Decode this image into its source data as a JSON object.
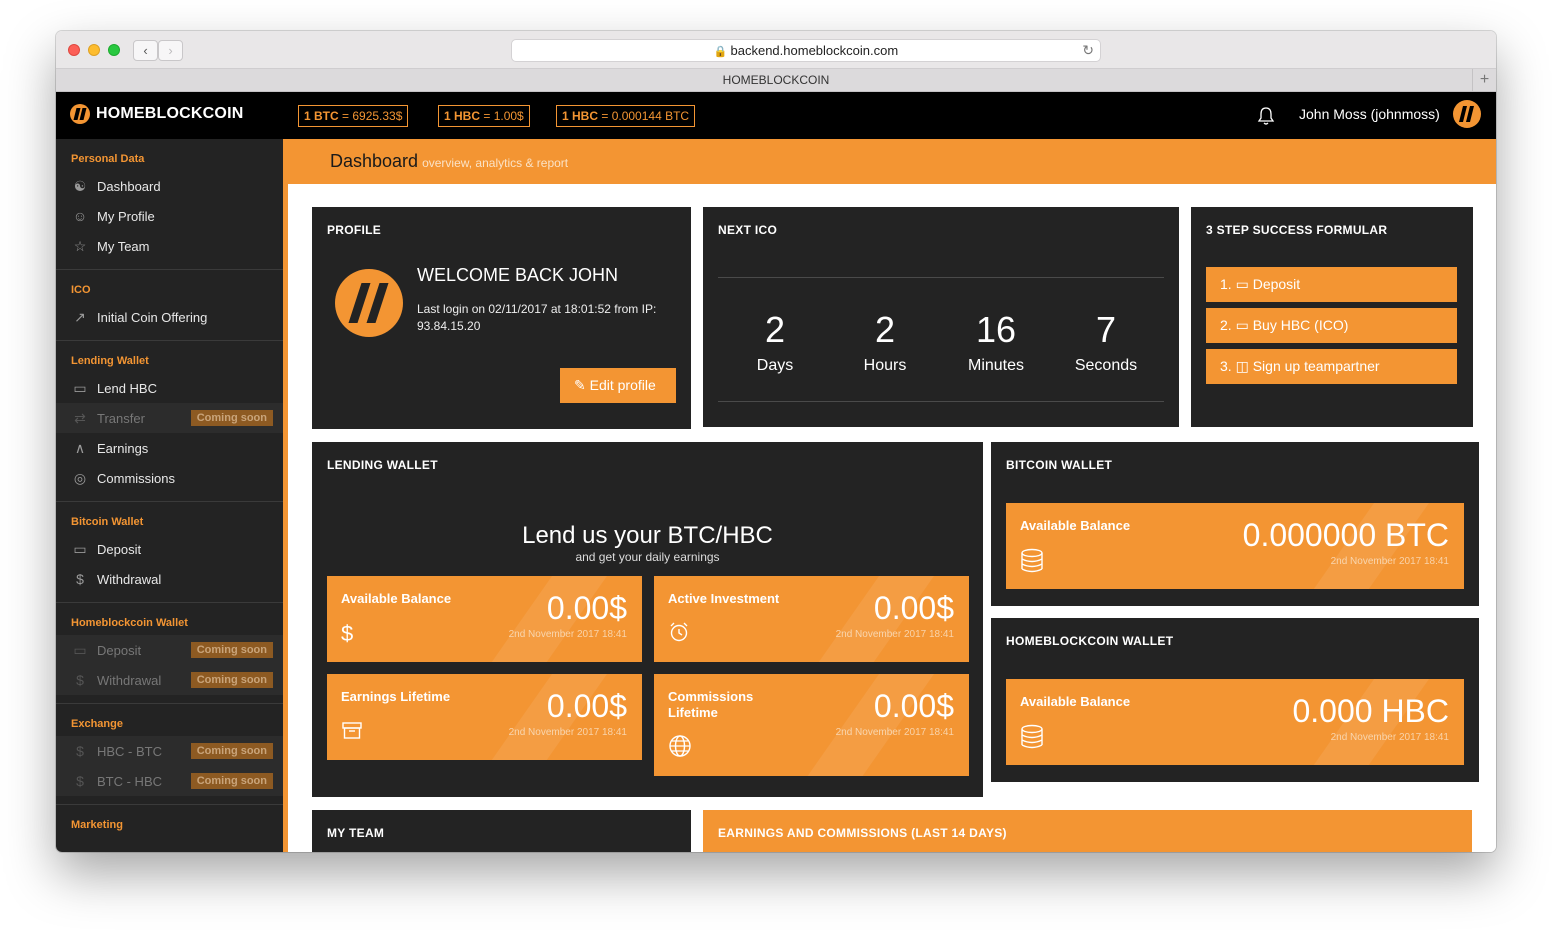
{
  "browser": {
    "url": "backend.homeblockcoin.com",
    "tab_title": "HOMEBLOCKCOIN"
  },
  "topbar": {
    "logo_text": "HOMEBLOCKCOIN",
    "tickers": [
      {
        "label": "1 BTC",
        "value": " = 6925.33$"
      },
      {
        "label": "1 HBC",
        "value": " = 1.00$"
      },
      {
        "label": "1 HBC",
        "value": " = 0.000144 BTC"
      }
    ],
    "user": "John Moss (johnmoss)"
  },
  "sidebar": {
    "sections": [
      {
        "title": "Personal Data",
        "items": [
          {
            "label": "Dashboard",
            "icon": "dashboard-icon"
          },
          {
            "label": "My Profile",
            "icon": "user-icon"
          },
          {
            "label": "My Team",
            "icon": "star-icon"
          }
        ]
      },
      {
        "title": "ICO",
        "items": [
          {
            "label": "Initial Coin Offering",
            "icon": "share-icon"
          }
        ]
      },
      {
        "title": "Lending Wallet",
        "items": [
          {
            "label": "Lend HBC",
            "icon": "card-icon"
          },
          {
            "label": "Transfer",
            "icon": "refresh-icon",
            "badge": "Coming soon"
          },
          {
            "label": "Earnings",
            "icon": "rocket-icon"
          },
          {
            "label": "Commissions",
            "icon": "globe-icon"
          }
        ]
      },
      {
        "title": "Bitcoin Wallet",
        "items": [
          {
            "label": "Deposit",
            "icon": "card-icon"
          },
          {
            "label": "Withdrawal",
            "icon": "dollar-icon"
          }
        ]
      },
      {
        "title": "Homeblockcoin Wallet",
        "items": [
          {
            "label": "Deposit",
            "icon": "card-icon",
            "badge": "Coming soon"
          },
          {
            "label": "Withdrawal",
            "icon": "dollar-icon",
            "badge": "Coming soon"
          }
        ]
      },
      {
        "title": "Exchange",
        "items": [
          {
            "label": "HBC - BTC",
            "icon": "dollar-icon",
            "badge": "Coming soon"
          },
          {
            "label": "BTC - HBC",
            "icon": "dollar-icon",
            "badge": "Coming soon"
          }
        ]
      },
      {
        "title": "Marketing",
        "items": []
      }
    ]
  },
  "header": {
    "title": "Dashboard",
    "subtitle": "overview, analytics & report"
  },
  "profile": {
    "title": "PROFILE",
    "welcome": "WELCOME BACK JOHN",
    "last_login": "Last login on 02/11/2017 at 18:01:52 from IP: 93.84.15.20",
    "edit_button": "Edit profile"
  },
  "next_ico": {
    "title": "NEXT ICO",
    "days": "2",
    "days_label": "Days",
    "hours": "2",
    "hours_label": "Hours",
    "minutes": "16",
    "minutes_label": "Minutes",
    "seconds": "7",
    "seconds_label": "Seconds"
  },
  "formula": {
    "title": "3 STEP SUCCESS FORMULAR",
    "steps": [
      {
        "num": "1.",
        "label": "Deposit",
        "icon": "card-icon"
      },
      {
        "num": "2.",
        "label": "Buy HBC (ICO)",
        "icon": "card-icon"
      },
      {
        "num": "3.",
        "label": "Sign up teampartner",
        "icon": "images-icon"
      }
    ]
  },
  "lending_wallet": {
    "title": "LENDING WALLET",
    "headline": "Lend us your BTC/HBC",
    "subline": "and get your daily earnings",
    "tiles": [
      {
        "label": "Available Balance",
        "value": "0.00$",
        "date": "2nd November 2017 18:41",
        "icon": "dollar-icon"
      },
      {
        "label": "Active Investment",
        "value": "0.00$",
        "date": "2nd November 2017 18:41",
        "icon": "alarm-icon"
      },
      {
        "label": "Earnings Lifetime",
        "value": "0.00$",
        "date": "2nd November 2017 18:41",
        "icon": "archive-icon"
      },
      {
        "label": "Commissions Lifetime",
        "value": "0.00$",
        "date": "2nd November 2017 18:41",
        "icon": "globe-icon"
      }
    ]
  },
  "bitcoin_wallet": {
    "title": "BITCOIN WALLET",
    "label": "Available Balance",
    "value": "0.000000 BTC",
    "date": "2nd November 2017 18:41",
    "icon": "database-icon"
  },
  "hbc_wallet": {
    "title": "HOMEBLOCKCOIN WALLET",
    "label": "Available Balance",
    "value": "0.000 HBC",
    "date": "2nd November 2017 18:41",
    "icon": "database-icon"
  },
  "my_team": {
    "title": "MY TEAM"
  },
  "earnings_chart": {
    "title": "EARNINGS AND COMMISSIONS (LAST 14 DAYS)"
  },
  "colors": {
    "accent": "#f39533",
    "panel": "#232323",
    "topbar": "#000000"
  }
}
